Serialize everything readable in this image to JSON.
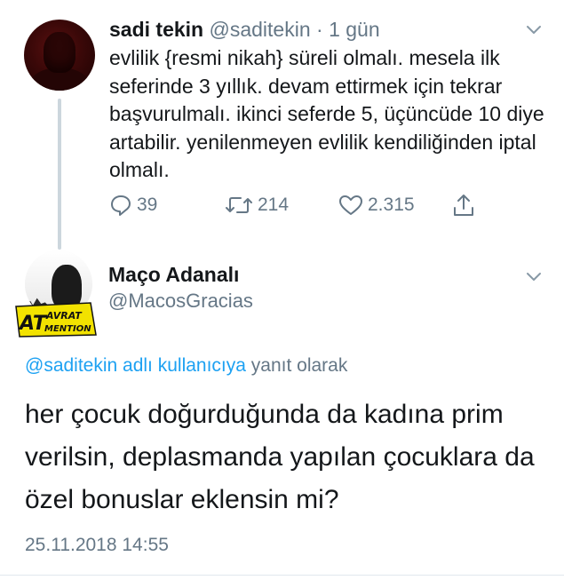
{
  "tweet1": {
    "display_name": "sadi tekin",
    "handle": "@saditekin",
    "separator": "·",
    "time": "1 gün",
    "text": "evlilik {resmi nikah} süreli olmalı. mesela ilk seferinde 3 yıllık. devam ettirmek için tekrar başvurulmalı. ikinci seferde 5, üçüncüde 10 diye artabilir. yenilenmeyen evlilik kendiliğinden iptal olmalı.",
    "replies": "39",
    "retweets": "214",
    "likes": "2.315",
    "icons": [
      "reply-icon",
      "retweet-icon",
      "like-icon",
      "share-icon",
      "chevron-down-icon"
    ]
  },
  "tweet2": {
    "display_name": "Maço Adanalı",
    "handle": "@MacosGracias",
    "avatar_badge": "AT AVRAT MENTION",
    "reply_mention": "@saditekin adlı kullanıcıya",
    "reply_suffix": " yanıt olarak",
    "text": "her çocuk doğurduğunda da kadına prim verilsin, deplasmanda yapılan çocuklara da özel bonuslar eklensin mi?",
    "date": "25.11.2018 14:55"
  },
  "colors": {
    "text": "#14171a",
    "secondary": "#657786",
    "link": "#1da1f2",
    "thread_line": "#ccd6dd",
    "badge_yellow": "#f2e200"
  }
}
